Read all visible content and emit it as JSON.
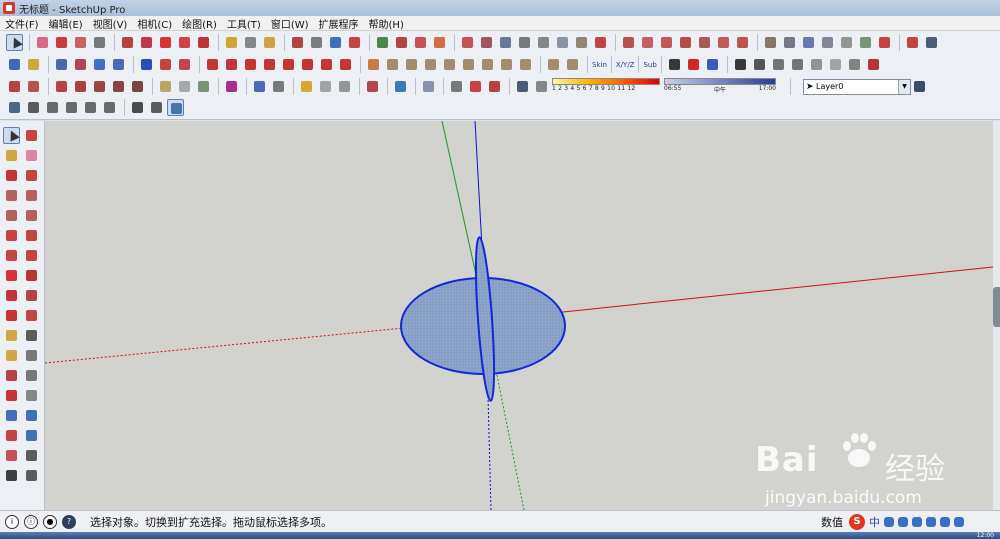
{
  "window": {
    "title": "无标题 - SketchUp Pro"
  },
  "menu": [
    "文件(F)",
    "编辑(E)",
    "视图(V)",
    "相机(C)",
    "绘图(R)",
    "工具(T)",
    "窗口(W)",
    "扩展程序",
    "帮助(H)"
  ],
  "toolbar": {
    "color_scale_numbers": "1 2 3 4 5 6 7 8 9 10 11 12",
    "time_start": "06:55",
    "time_mid": "中午",
    "time_end": "17:00",
    "plugin_labels": [
      "Skin",
      "X/Y/Z",
      "Sub"
    ],
    "layer_value": "Layer0"
  },
  "status": {
    "hint_text": "选择对象。切换到扩充选择。拖动鼠标选择多项。",
    "measure_label": "数值",
    "ime_label": "中"
  },
  "taskbar": {
    "clock": "12:00"
  },
  "watermark": {
    "brand": "Bai",
    "brand_cn": "经验",
    "url": "jingyan.baidu.com"
  },
  "colors": {
    "red_axis": "#d01010",
    "green_axis": "#1a9a1a",
    "blue_axis": "#1010d0",
    "face_fill": "#8fa6cc",
    "edge": "#0f28d8",
    "background": "#d2d2ce"
  }
}
